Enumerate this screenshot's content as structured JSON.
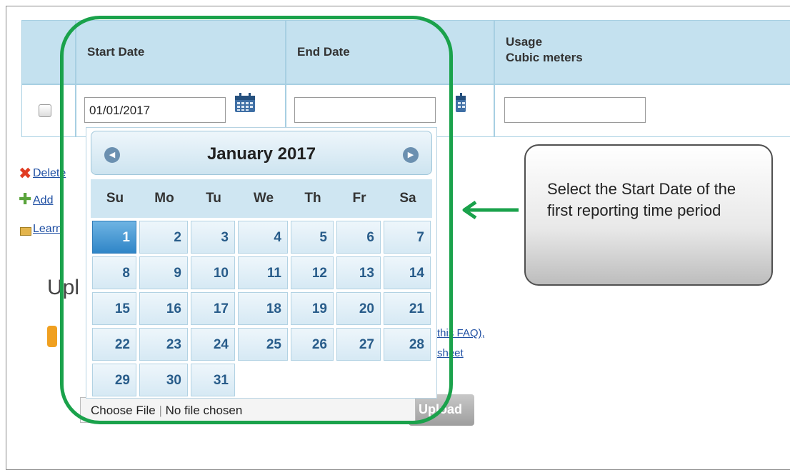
{
  "table": {
    "headers": {
      "start_date": "Start Date",
      "end_date": "End Date",
      "usage_line1": "Usage",
      "usage_line2": "Cubic meters"
    },
    "row": {
      "start_value": "01/01/2017",
      "end_value": "",
      "usage_value": ""
    }
  },
  "links": {
    "delete": "Delete",
    "add": "Add",
    "learn": "Learn"
  },
  "upload": {
    "title": "Upl",
    "faq_link": "this FAQ),",
    "sheet_link": "sheet",
    "choose_file": "Choose File",
    "no_file": "No file chosen",
    "upload_button": "Upload"
  },
  "datepicker": {
    "month_label": "January 2017",
    "weekdays": [
      "Su",
      "Mo",
      "Tu",
      "We",
      "Th",
      "Fr",
      "Sa"
    ],
    "weeks": [
      [
        "1",
        "2",
        "3",
        "4",
        "5",
        "6",
        "7"
      ],
      [
        "8",
        "9",
        "10",
        "11",
        "12",
        "13",
        "14"
      ],
      [
        "15",
        "16",
        "17",
        "18",
        "19",
        "20",
        "21"
      ],
      [
        "22",
        "23",
        "24",
        "25",
        "26",
        "27",
        "28"
      ],
      [
        "29",
        "30",
        "31",
        "",
        "",
        "",
        ""
      ]
    ],
    "selected_day": "1"
  },
  "callout": {
    "text": "Select the Start Date of the first reporting time period"
  },
  "colors": {
    "highlight": "#1aa24b",
    "header_bg": "#c4e1ef",
    "selected_day": "#2f85c7"
  }
}
